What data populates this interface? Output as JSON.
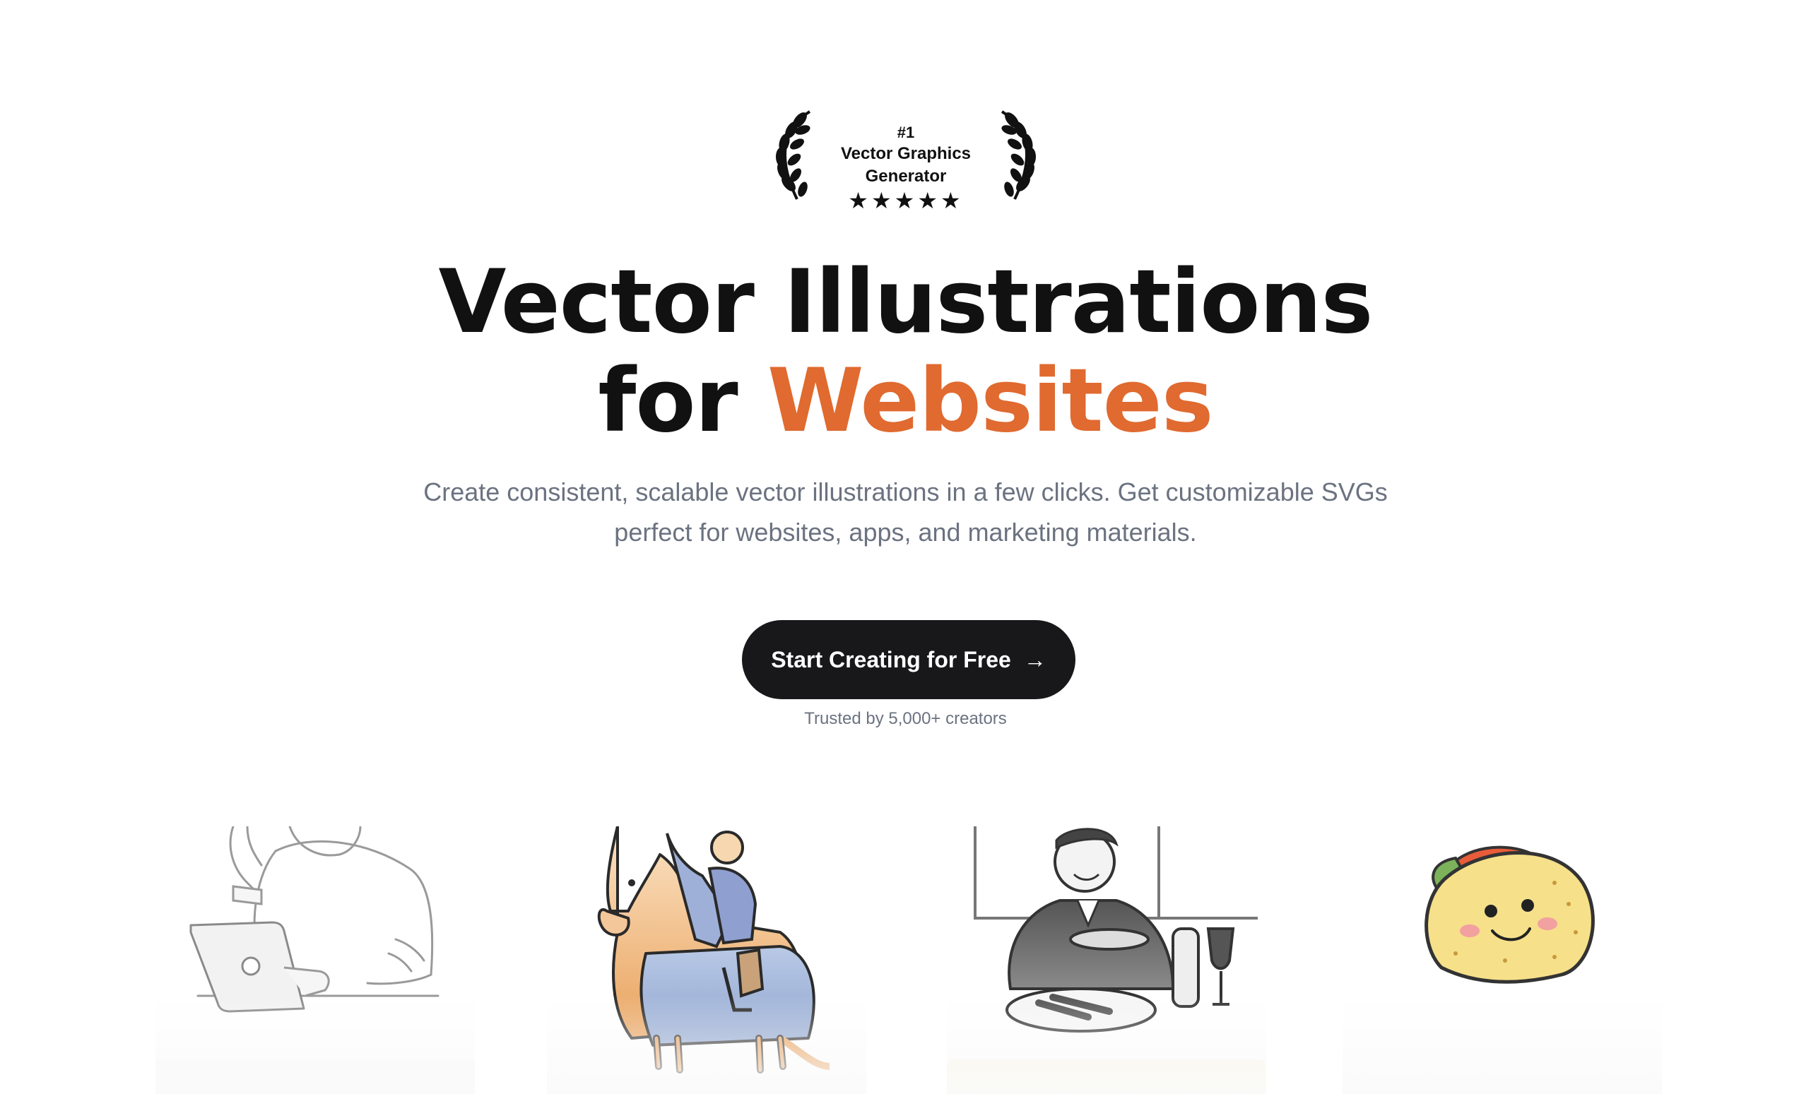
{
  "award": {
    "rank": "#1",
    "title": "Vector Graphics Generator",
    "stars": "★★★★★"
  },
  "hero": {
    "line1": "Vector Illustrations",
    "line2_prefix": "for ",
    "line2_accent": "Websites",
    "subtitle_line1": "Create consistent, scalable vector illustrations in a few clicks. Get customizable SVGs",
    "subtitle_line2": "perfect for websites, apps, and marketing materials."
  },
  "cta": {
    "label": "Start Creating for Free",
    "icon": "→",
    "trusted": "Trusted by 5,000+ creators"
  },
  "gallery": {
    "items": [
      {
        "icon": "person-laptop-illustration"
      },
      {
        "icon": "horse-rider-illustration"
      },
      {
        "icon": "man-dining-illustration"
      },
      {
        "icon": "taco-character-illustration"
      }
    ]
  },
  "colors": {
    "accent": "#e06a30",
    "button_bg": "#18181b",
    "muted_text": "#6b7280"
  }
}
